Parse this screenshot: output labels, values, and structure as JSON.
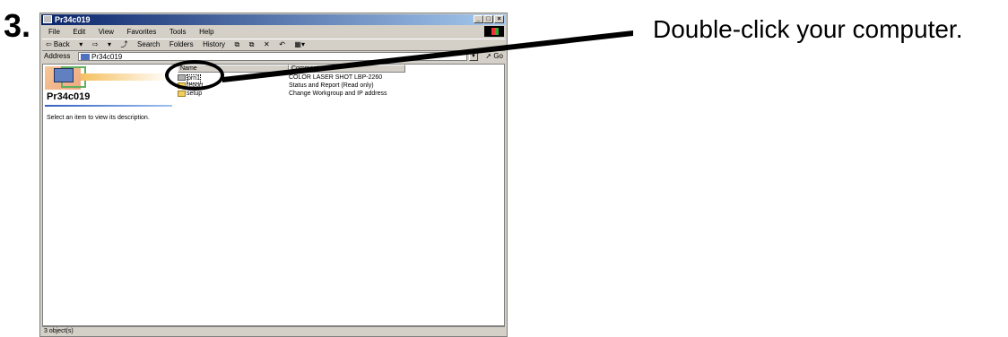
{
  "step_number": "3.",
  "instruction": "Double-click your computer.",
  "window": {
    "title": "Pr34c019",
    "controls": [
      "_",
      "□",
      "×"
    ],
    "menu": [
      "File",
      "Edit",
      "View",
      "Favorites",
      "Tools",
      "Help"
    ],
    "toolbar": [
      "⇦ Back",
      "▾",
      "⇨",
      "▾",
      "⤴",
      "Search",
      "Folders",
      "History",
      "⧉",
      "⧉",
      "✕",
      "↶",
      "▦▾"
    ],
    "address_label": "Address",
    "address_value": "Pr34c019",
    "go_label": "Go",
    "folder_title": "Pr34c019",
    "description": "Select an item to view its description.",
    "columns": {
      "name": "Name",
      "comment": "Comment"
    },
    "items": [
      {
        "name": "prn1",
        "comment": "COLOR LASER SHOT LBP-2260",
        "icon": "printer-icon"
      },
      {
        "name": "report",
        "comment": "Status and Report (Read only)",
        "icon": "folder-icon"
      },
      {
        "name": "setup",
        "comment": "Change Workgroup and IP address",
        "icon": "folder-icon"
      }
    ],
    "status": "3 object(s)"
  },
  "colors": {
    "titlebar": "#0a246a",
    "chrome": "#d4d0c8"
  }
}
